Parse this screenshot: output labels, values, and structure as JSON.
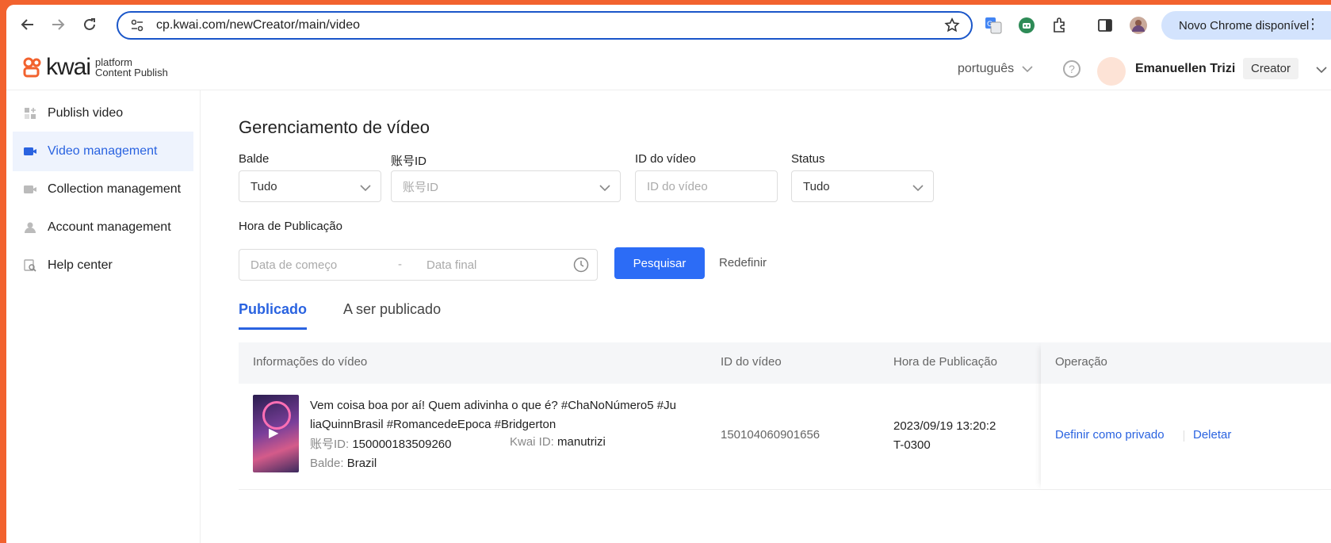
{
  "browser": {
    "url": "cp.kwai.com/newCreator/main/video",
    "update_label": "Novo Chrome disponível"
  },
  "header": {
    "brand_word": "kwai",
    "brand_tag_1": "platform",
    "brand_tag_2": "Content Publish",
    "language": "português",
    "user_name": "Emanuellen Trizi",
    "role": "Creator"
  },
  "sidebar": {
    "items": [
      {
        "label": "Publish video",
        "icon": "publish-icon"
      },
      {
        "label": "Video management",
        "icon": "video-icon"
      },
      {
        "label": "Collection management",
        "icon": "collection-icon"
      },
      {
        "label": "Account management",
        "icon": "account-icon"
      },
      {
        "label": "Help center",
        "icon": "help-center-icon"
      }
    ],
    "active_index": 1
  },
  "main": {
    "title": "Gerenciamento de vídeo",
    "filters": {
      "bucket_label": "Balde",
      "bucket_value": "Tudo",
      "account_label": "账号ID",
      "account_placeholder": "账号ID",
      "video_id_label": "ID do vídeo",
      "video_id_placeholder": "ID do vídeo",
      "status_label": "Status",
      "status_value": "Tudo",
      "pub_time_label": "Hora de Publicação",
      "start_placeholder": "Data de começo",
      "range_sep": "-",
      "end_placeholder": "Data final",
      "search_button": "Pesquisar",
      "reset_button": "Redefinir"
    },
    "tabs": [
      {
        "label": "Publicado",
        "active": true
      },
      {
        "label": "A ser publicado",
        "active": false
      }
    ],
    "table": {
      "headers": [
        "Informações do vídeo",
        "ID do vídeo",
        "Hora de Publicação",
        "Operação"
      ],
      "rows": [
        {
          "title": "Vem coisa boa por aí! Quem adivinha o que é? #ChaNoNúmero5 #JuliaQuinnBrasil #RomancedeEpoca #Bridgerton",
          "title_line1": "Vem coisa boa por aí! Quem adivinha o que é? #ChaNoNúmero5 #Ju",
          "title_line2": "liaQuinnBrasil #RomancedeEpoca #Bridgerton",
          "account_key": "账号ID:",
          "account_val": "150000183509260",
          "kwai_key": "Kwai ID:",
          "kwai_val": "manutrizi",
          "bucket_key": "Balde:",
          "bucket_val": "Brazil",
          "video_id": "150104060901656",
          "pub_line1": "2023/09/19 13:20:2",
          "pub_line2": "T-0300",
          "op_private": "Definir como privado",
          "op_delete": "Deletar"
        }
      ]
    }
  },
  "colors": {
    "accent": "#2c6cf6",
    "brand": "#f2622e",
    "active_bg": "#eef3fd"
  }
}
